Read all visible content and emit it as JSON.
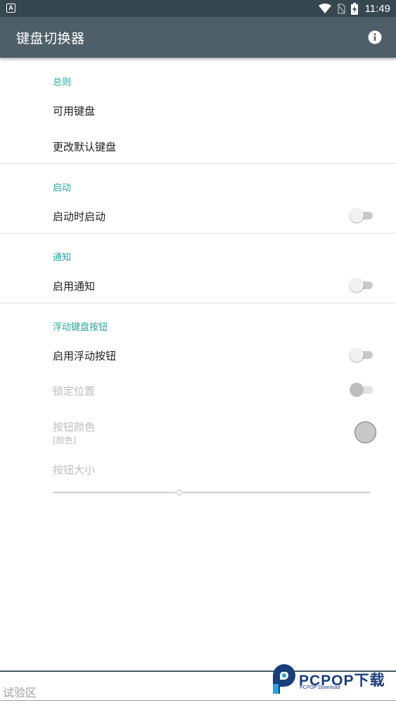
{
  "status_bar": {
    "notification_badge": "A",
    "time": "11:49",
    "icons": [
      "wifi-icon",
      "no-sim-icon",
      "battery-charging-icon"
    ]
  },
  "app_bar": {
    "title": "键盘切换器",
    "action_icon": "info-icon"
  },
  "sections": {
    "general": {
      "title": "总则",
      "items": [
        "可用键盘",
        "更改默认键盘"
      ]
    },
    "startup": {
      "title": "启动",
      "start_on_boot": {
        "label": "启动时启动",
        "enabled": false
      }
    },
    "notification": {
      "title": "通知",
      "enable_notification": {
        "label": "启用通知",
        "enabled": false
      }
    },
    "floating_button": {
      "title": "浮动键盘按钮",
      "enable_floating": {
        "label": "启用浮动按钮",
        "enabled": false
      },
      "lock_position": {
        "label": "锁定位置",
        "enabled": false,
        "disabled": true
      },
      "button_color": {
        "label": "按钮颜色",
        "summary": "[颜色]",
        "color": "#c8c8c8",
        "disabled": true
      },
      "button_size": {
        "label": "按钮大小",
        "value_fraction": 0.4,
        "disabled": true
      }
    }
  },
  "test_area": {
    "placeholder": "试验区"
  },
  "watermark": {
    "brand": "PCPOP下载",
    "tagline": "PCPOP Download"
  },
  "colors": {
    "status_bar": "#37474f",
    "app_bar": "#4e5f69",
    "accent": "#26a69a"
  }
}
